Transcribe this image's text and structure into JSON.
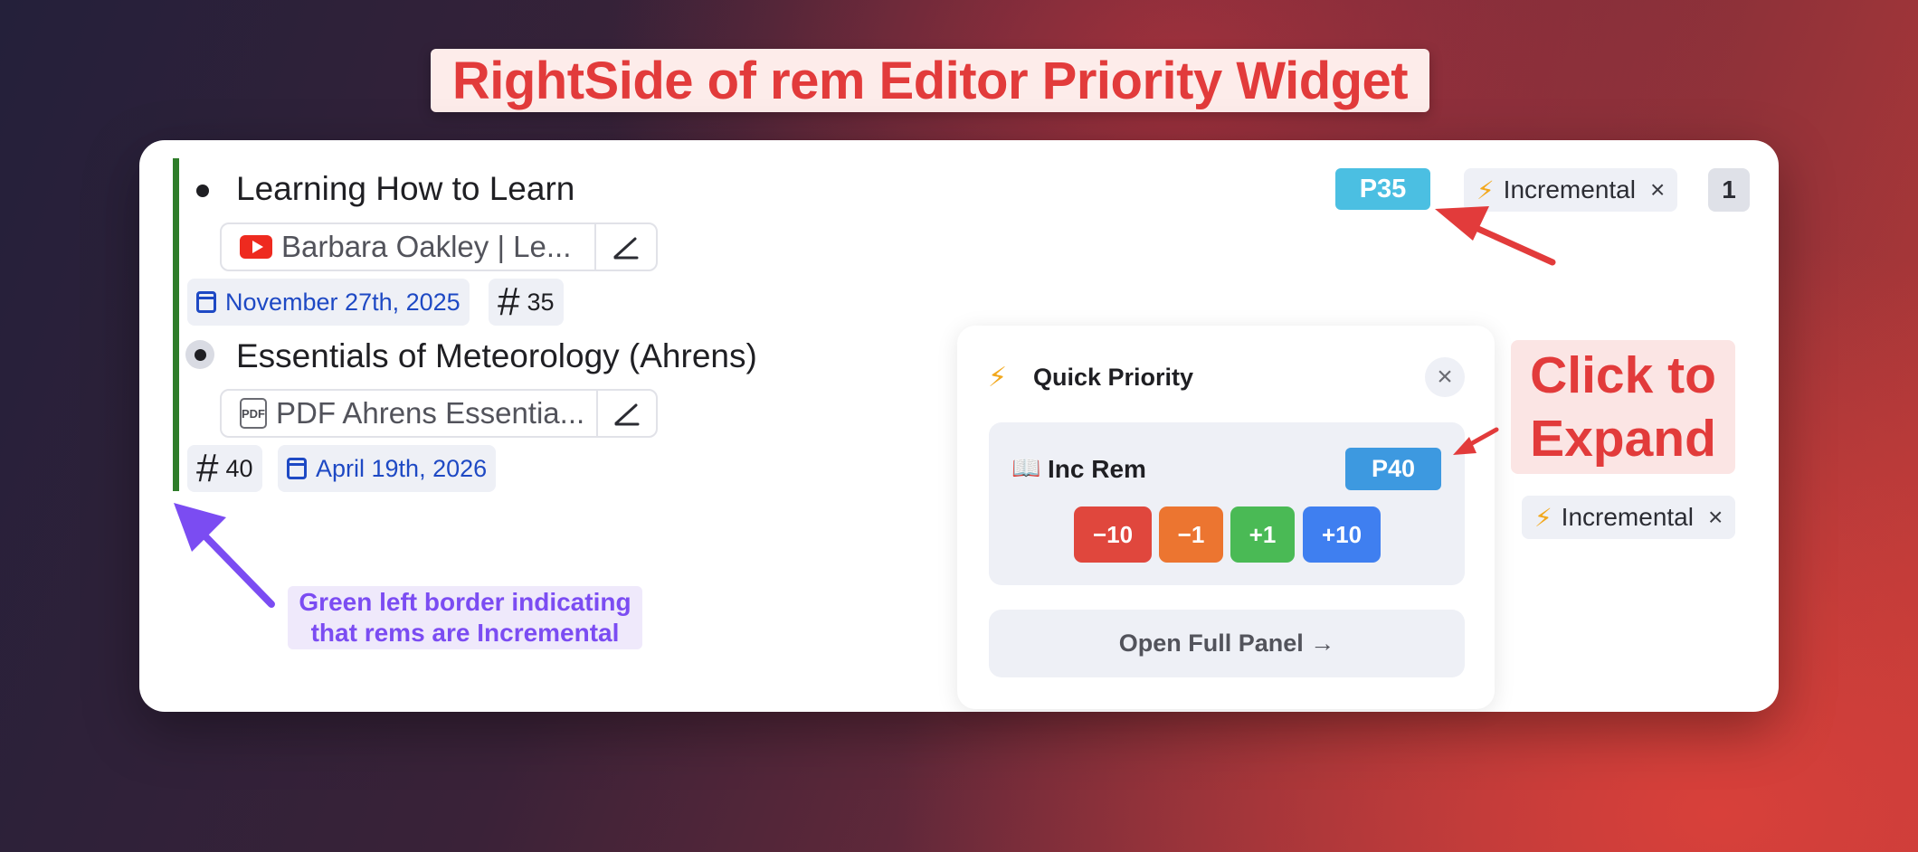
{
  "banner": {
    "title": "RightSide of rem Editor Priority Widget"
  },
  "rems": [
    {
      "title": "Learning How to Learn",
      "source_icon": "youtube-icon",
      "source_label": "Barbara Oakley | Le...",
      "date": "November 27th, 2025",
      "priority_tag": "35"
    },
    {
      "title": "Essentials of Meteorology (Ahrens)",
      "source_icon": "pdf-icon",
      "source_label": "PDF Ahrens Essentia...",
      "date": "April 19th, 2026",
      "priority_tag": "40"
    }
  ],
  "right_side": {
    "priority_badge": "P35",
    "incremental_label": "Incremental",
    "count": "1",
    "second_incremental_label": "Incremental"
  },
  "popup": {
    "title": "Quick Priority",
    "rem_type": "Inc Rem",
    "priority": "P40",
    "buttons": [
      "−10",
      "−1",
      "+1",
      "+10"
    ],
    "open_panel": "Open Full Panel →"
  },
  "annotations": {
    "click_to_expand_line1": "Click to",
    "click_to_expand_line2": "Expand",
    "green_border_line1": "Green left border indicating",
    "green_border_line2": "that rems are Incremental"
  },
  "colors": {
    "accent_red": "#e23b3b",
    "incremental_border": "#2f7d2a",
    "note_purple": "#7b4cf2",
    "btn_minus10": "#e0473d",
    "btn_minus1": "#ec7530",
    "btn_plus1": "#4aba55",
    "btn_plus10": "#3f7ff0"
  }
}
